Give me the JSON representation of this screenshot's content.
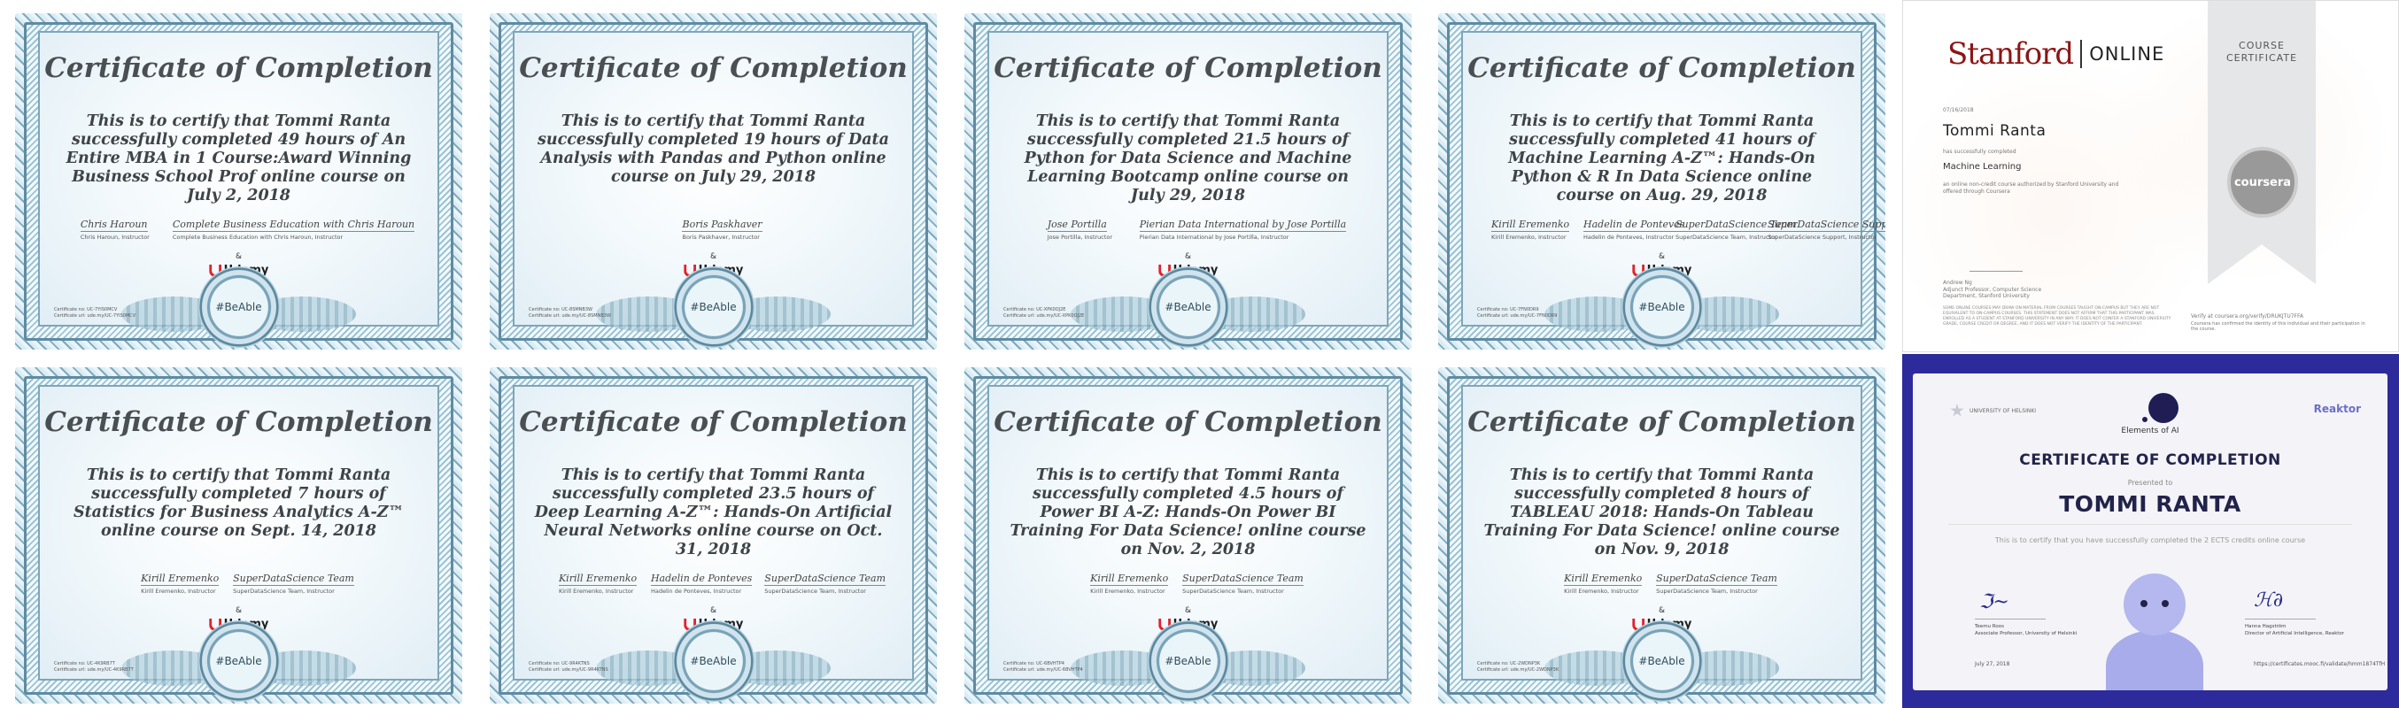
{
  "common": {
    "title": "Certificate of Completion",
    "amp": "&",
    "udemy": "Udemy",
    "hashtag": "#BeAble"
  },
  "certificates": [
    {
      "id": "cert-1",
      "body": "This is to certify that Tommi Ranta successfully completed 49 hours of An Entire MBA in 1 Course:Award Winning Business School Prof online course on July 2, 2018",
      "signatures": [
        {
          "sign": "Chris Haroun",
          "cap": "Chris Haroun, Instructor"
        },
        {
          "sign": "Complete Business Education with Chris Haroun",
          "cap": "Complete Business Education with Chris Haroun, Instructor"
        }
      ],
      "cid": "Certificate no: UC-7YIS0MCV\nCertificate url: ude.my/UC-7YIS0MCV"
    },
    {
      "id": "cert-2",
      "body": "This is to certify that Tommi Ranta successfully completed 19 hours of Data Analysis with Pandas and Python online course on July 29, 2018",
      "signatures": [
        {
          "sign": "Boris Paskhaver",
          "cap": "Boris Paskhaver, Instructor"
        }
      ],
      "cid": "Certificate no: UC-8SMNB3W\nCertificate url: ude.my/UC-8SMNB3W"
    },
    {
      "id": "cert-3",
      "body": "This is to certify that Tommi Ranta successfully completed 21.5 hours of Python for Data Science and Machine Learning Bootcamp online course on July 29, 2018",
      "signatures": [
        {
          "sign": "Jose Portilla",
          "cap": "Jose Portilla, Instructor"
        },
        {
          "sign": "Pierian Data International by Jose Portilla",
          "cap": "Pierian Data International by Jose Portilla, Instructor"
        }
      ],
      "cid": "Certificate no: UC-XPK0OJ2E\nCertificate url: ude.my/UC-XPK0OJ2E"
    },
    {
      "id": "cert-4",
      "body": "This is to certify that Tommi Ranta successfully completed 41 hours of Machine Learning A-Z™: Hands-On Python & R In Data Science online course on Aug. 29, 2018",
      "signatures": [
        {
          "sign": "Kirill Eremenko",
          "cap": "Kirill Eremenko, Instructor"
        },
        {
          "sign": "Hadelin de Ponteves",
          "cap": "Hadelin de Ponteves, Instructor"
        },
        {
          "sign": "SuperDataScience Team",
          "cap": "SuperDataScience Team, Instructor"
        },
        {
          "sign": "SuperDataScience Support",
          "cap": "SuperDataScience Support, Instructor"
        }
      ],
      "cid": "Certificate no: UC-7FN0DR9\nCertificate url: ude.my/UC-7FN0DR9"
    },
    {
      "id": "cert-5",
      "body": "This is to certify that Tommi Ranta successfully completed 7 hours of Statistics for Business Analytics A-Z™ online course on Sept. 14, 2018",
      "signatures": [
        {
          "sign": "Kirill Eremenko",
          "cap": "Kirill Eremenko, Instructor"
        },
        {
          "sign": "SuperDataScience Team",
          "cap": "SuperDataScience Team, Instructor"
        }
      ],
      "cid": "Certificate no: UC-4K9RB7T\nCertificate url: ude.my/UC-4K9RB7T"
    },
    {
      "id": "cert-6",
      "body": "This is to certify that Tommi Ranta successfully completed 23.5 hours of Deep Learning A-Z™: Hands-On Artificial Neural Networks online course on Oct. 31, 2018",
      "signatures": [
        {
          "sign": "Kirill Eremenko",
          "cap": "Kirill Eremenko, Instructor"
        },
        {
          "sign": "Hadelin de Ponteves",
          "cap": "Hadelin de Ponteves, Instructor"
        },
        {
          "sign": "SuperDataScience Team",
          "cap": "SuperDataScience Team, Instructor"
        }
      ],
      "cid": "Certificate no: UC-9R4KTNS\nCertificate url: ude.my/UC-9R4KTNS"
    },
    {
      "id": "cert-7",
      "body": "This is to certify that Tommi Ranta successfully completed 4.5 hours of Power BI A-Z: Hands-On Power BI Training For Data Science! online course on Nov. 2, 2018",
      "signatures": [
        {
          "sign": "Kirill Eremenko",
          "cap": "Kirill Eremenko, Instructor"
        },
        {
          "sign": "SuperDataScience Team",
          "cap": "SuperDataScience Team, Instructor"
        }
      ],
      "cid": "Certificate no: UC-6BVHTP4\nCertificate url: ude.my/UC-6BVHTP4"
    },
    {
      "id": "cert-8",
      "body": "This is to certify that Tommi Ranta successfully completed 8 hours of TABLEAU 2018: Hands-On Tableau Training For Data Science! online course on Nov. 9, 2018",
      "signatures": [
        {
          "sign": "Kirill Eremenko",
          "cap": "Kirill Eremenko, Instructor"
        },
        {
          "sign": "SuperDataScience Team",
          "cap": "SuperDataScience Team, Instructor"
        }
      ],
      "cid": "Certificate no: UC-2WDNP3K\nCertificate url: ude.my/UC-2WDNP3K"
    }
  ],
  "stanford": {
    "brand": "Stanford",
    "online": "ONLINE",
    "ribbon_line1": "COURSE",
    "ribbon_line2": "CERTIFICATE",
    "date": "07/16/2018",
    "name": "Tommi Ranta",
    "completed": "has successfully completed",
    "course": "Machine Learning",
    "desc": "an online non-credit course authorized by Stanford University and offered through Coursera",
    "seal": "coursera",
    "signer": "Andrew Ng",
    "signer_title": "Adjunct Professor, Computer Science Department, Stanford University",
    "verify": "Verify at coursera.org/verify/DRUKJTU7FFA",
    "verify_sub": "Coursera has confirmed the identity of this individual and their participation in the course.",
    "fine": "SOME ONLINE COURSES MAY DRAW ON MATERIAL FROM COURSES TAUGHT ON-CAMPUS BUT THEY ARE NOT EQUIVALENT TO ON-CAMPUS COURSES. THIS STATEMENT DOES NOT AFFIRM THAT THIS PARTICIPANT WAS ENROLLED AS A STUDENT AT STANFORD UNIVERSITY IN ANY WAY. IT DOES NOT CONFER A STANFORD UNIVERSITY GRADE, COURSE CREDIT OR DEGREE, AND IT DOES NOT VERIFY THE IDENTITY OF THE PARTICIPANT."
  },
  "eai": {
    "university": "UNIVERSITY OF HELSINKI",
    "partner": "Reaktor",
    "product": "Elements of AI",
    "title": "CERTIFICATE OF COMPLETION",
    "presented": "Presented to",
    "name": "TOMMI RANTA",
    "statement": "This is to certify that you have successfully completed the 2 ECTS credits online course",
    "sig_left_name": "Teemu Roos",
    "sig_left_title": "Associate Professor, University of Helsinki",
    "sig_right_name": "Hanna Hagström",
    "sig_right_title": "Director of Artificial Intelligence, Reaktor",
    "date": "July 27, 2018",
    "url": "https://certificates.mooc.fi/validate/hmm1874TfH"
  },
  "colors": {
    "frame": "#9fc7d6",
    "title_text": "#4a4f53",
    "udemy_red": "#e3222b",
    "stanford_red": "#8c1515",
    "eai_bg": "#2d2a9b",
    "eai_accent": "#6b6fc7"
  }
}
